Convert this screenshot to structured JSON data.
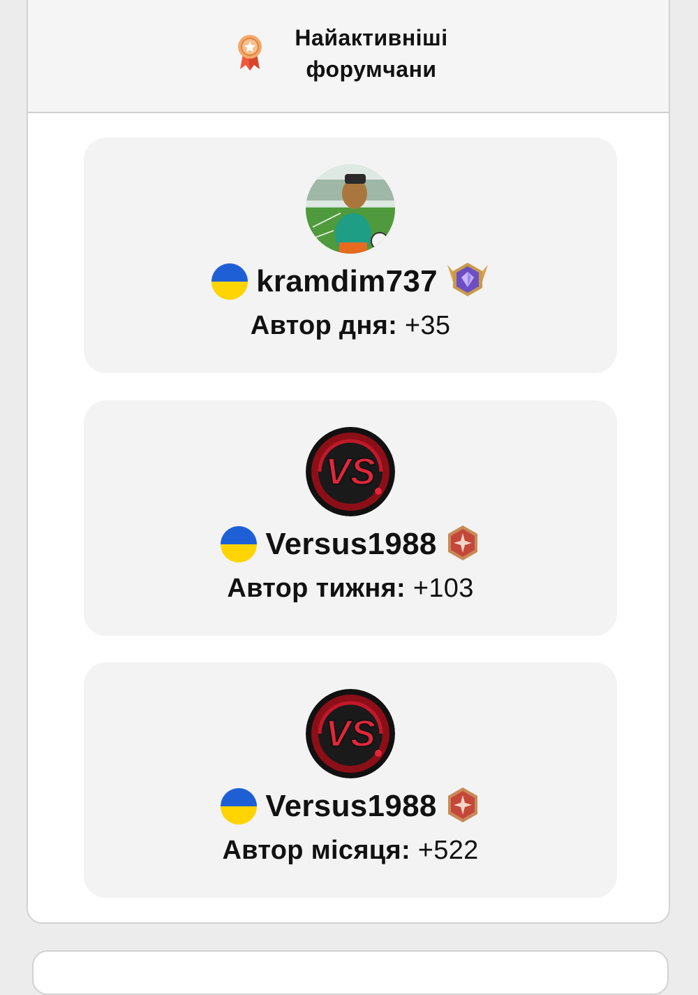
{
  "widget": {
    "title_line1": "Найактивніші",
    "title_line2": "форумчани",
    "icon": "medal-icon",
    "accent": "#f08a4b"
  },
  "authors": [
    {
      "username": "kramdim737",
      "avatar": "bearded-dragon-football-avatar",
      "flag": "ukraine-flag-icon",
      "rank_badge": "purple-diamond-rank-badge",
      "period_label": "Автор дня:",
      "score": "+35"
    },
    {
      "username": "Versus1988",
      "avatar": "vs-logo-avatar",
      "flag": "ukraine-flag-icon",
      "rank_badge": "bronze-star-rank-badge",
      "period_label": "Автор тижня:",
      "score": "+103"
    },
    {
      "username": "Versus1988",
      "avatar": "vs-logo-avatar",
      "flag": "ukraine-flag-icon",
      "rank_badge": "bronze-star-rank-badge",
      "period_label": "Автор місяця:",
      "score": "+522"
    }
  ]
}
